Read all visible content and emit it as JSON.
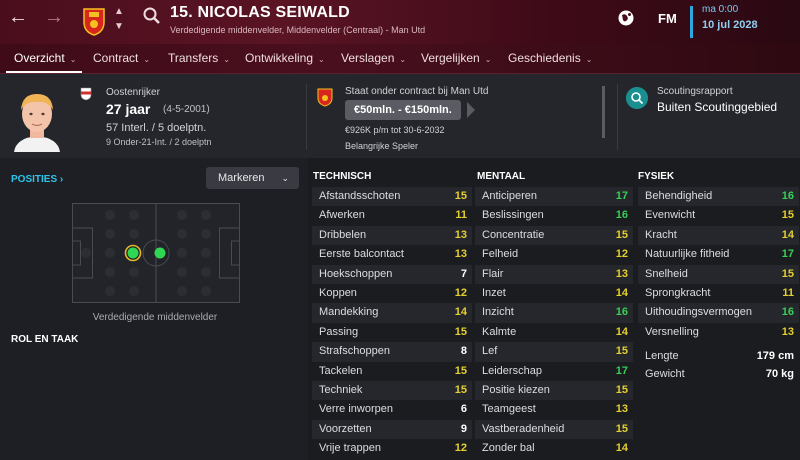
{
  "header": {
    "player_title": "15. NICOLAS SEIWALD",
    "player_subtitle": "Verdedigende middenvelder, Middenvelder (Centraal) - Man Utd",
    "logo": "FM",
    "date_day": "ma 0:00",
    "date_full": "10 jul 2028",
    "icons": [
      "back-arrow-icon",
      "forward-arrow-icon",
      "club-crest-icon",
      "up-down-icon",
      "search-icon",
      "globe-icon"
    ]
  },
  "tabs": [
    {
      "label": "Overzicht"
    },
    {
      "label": "Contract"
    },
    {
      "label": "Transfers"
    },
    {
      "label": "Ontwikkeling"
    },
    {
      "label": "Verslagen"
    },
    {
      "label": "Vergelijken"
    },
    {
      "label": "Geschiedenis"
    }
  ],
  "info": {
    "nationality": "Oostenrijker",
    "age": "27 jaar",
    "dob": "(4-5-2001)",
    "caps": "57 Interl. / 5 doelptn.",
    "u21caps": "9 Onder-21-Int. / 2 doelptn",
    "contract_status": "Staat onder contract bij Man Utd",
    "value": "€50mln. - €150mln.",
    "wage": "€926K p/m tot 30-6-2032",
    "squad_status": "Belangrijke Speler",
    "scout_label": "Scoutingsrapport",
    "scout_value": "Buiten Scoutinggebied"
  },
  "left": {
    "positions_link": "POSITIES",
    "markeren_label": "Markeren",
    "position_label": "Verdedigende middenvelder",
    "role_heading": "ROL EN TAAK"
  },
  "colors": {
    "high": "#36d054",
    "mid": "#e3cf2f",
    "low": "#ffffff",
    "accent": "#2ec3ea"
  },
  "technical": {
    "heading": "TECHNISCH",
    "rows": [
      {
        "name": "Afstandsschoten",
        "value": "15"
      },
      {
        "name": "Afwerken",
        "value": "11"
      },
      {
        "name": "Dribbelen",
        "value": "13"
      },
      {
        "name": "Eerste balcontact",
        "value": "13"
      },
      {
        "name": "Hoekschoppen",
        "value": "7"
      },
      {
        "name": "Koppen",
        "value": "12"
      },
      {
        "name": "Mandekking",
        "value": "14"
      },
      {
        "name": "Passing",
        "value": "15"
      },
      {
        "name": "Strafschoppen",
        "value": "8"
      },
      {
        "name": "Tackelen",
        "value": "15"
      },
      {
        "name": "Techniek",
        "value": "15"
      },
      {
        "name": "Verre inworpen",
        "value": "6"
      },
      {
        "name": "Voorzetten",
        "value": "9"
      },
      {
        "name": "Vrije trappen",
        "value": "12"
      }
    ]
  },
  "mental": {
    "heading": "MENTAAL",
    "rows": [
      {
        "name": "Anticiperen",
        "value": "17"
      },
      {
        "name": "Beslissingen",
        "value": "16"
      },
      {
        "name": "Concentratie",
        "value": "15"
      },
      {
        "name": "Felheid",
        "value": "12"
      },
      {
        "name": "Flair",
        "value": "13"
      },
      {
        "name": "Inzet",
        "value": "14"
      },
      {
        "name": "Inzicht",
        "value": "16"
      },
      {
        "name": "Kalmte",
        "value": "14"
      },
      {
        "name": "Lef",
        "value": "15"
      },
      {
        "name": "Leiderschap",
        "value": "17"
      },
      {
        "name": "Positie kiezen",
        "value": "15"
      },
      {
        "name": "Teamgeest",
        "value": "13"
      },
      {
        "name": "Vastberadenheid",
        "value": "15"
      },
      {
        "name": "Zonder bal",
        "value": "14"
      }
    ]
  },
  "physical": {
    "heading": "FYSIEK",
    "rows": [
      {
        "name": "Behendigheid",
        "value": "16"
      },
      {
        "name": "Evenwicht",
        "value": "15"
      },
      {
        "name": "Kracht",
        "value": "14"
      },
      {
        "name": "Natuurlijke fitheid",
        "value": "17"
      },
      {
        "name": "Snelheid",
        "value": "15"
      },
      {
        "name": "Sprongkracht",
        "value": "11"
      },
      {
        "name": "Uithoudingsvermogen",
        "value": "16"
      },
      {
        "name": "Versnelling",
        "value": "13"
      }
    ],
    "extra": [
      {
        "name": "Lengte",
        "value": "179 cm"
      },
      {
        "name": "Gewicht",
        "value": "70 kg"
      }
    ]
  }
}
